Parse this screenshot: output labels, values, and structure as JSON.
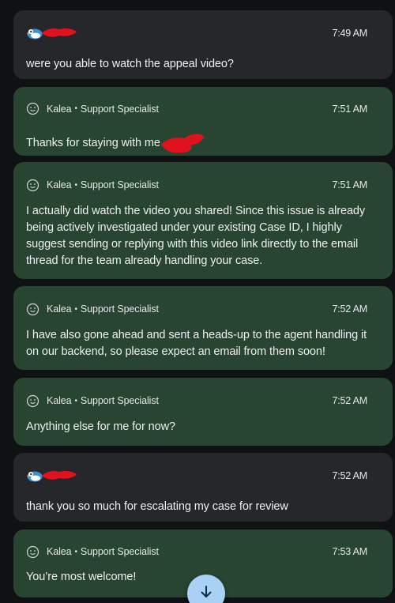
{
  "messages": [
    {
      "sender": "user",
      "time": "7:49 AM",
      "text": "were you able to watch the appeal video?"
    },
    {
      "sender": "agent",
      "author": "Kalea",
      "role": "Support Specialist",
      "time": "7:51 AM",
      "text": "Thanks for staying with me"
    },
    {
      "sender": "agent",
      "author": "Kalea",
      "role": "Support Specialist",
      "time": "7:51 AM",
      "text": "I actually did watch the video you shared! Since this issue is already being actively investigated under your existing Case ID, I highly suggest sending or replying with this video link directly to the email thread for the team already handling your case."
    },
    {
      "sender": "agent",
      "author": "Kalea",
      "role": "Support Specialist",
      "time": "7:52 AM",
      "text": "I have also gone ahead and sent a heads-up to the agent handling it on our backend, so please expect an email from them soon!"
    },
    {
      "sender": "agent",
      "author": "Kalea",
      "role": "Support Specialist",
      "time": "7:52 AM",
      "text": "Anything else for me for now?"
    },
    {
      "sender": "user",
      "time": "7:52 AM",
      "text": "thank you so much for escalating my case for review"
    },
    {
      "sender": "agent",
      "author": "Kalea",
      "role": "Support Specialist",
      "time": "7:53 AM",
      "text": "You’re most welcome!"
    }
  ],
  "separator": "•",
  "icons": {
    "agent_avatar": "smiley-face-icon",
    "user_avatar": "bird-avatar-icon",
    "scroll_button": "arrow-down-icon"
  },
  "colors": {
    "background": "#101112",
    "user_bubble": "#25272a",
    "agent_bubble": "#274530",
    "redaction": "#e0121e",
    "scroll_button": "#a9d0f5"
  }
}
